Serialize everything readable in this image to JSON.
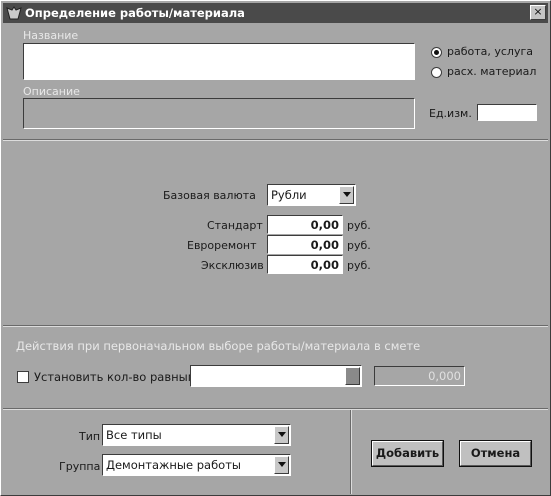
{
  "window": {
    "title": "Определение работы/материала",
    "close_glyph": "×"
  },
  "name_label": "Название",
  "name_value": "",
  "description_label": "Описание",
  "description_value": "",
  "item_kind": {
    "options": [
      "работа, услуга",
      "расх. материал"
    ],
    "selected": "работа, услуга"
  },
  "unit_label": "Ед.изм.",
  "unit_value": "",
  "currency_label": "Базовая валюта",
  "currency_value": "Рубли",
  "prices": [
    {
      "label": "Стандарт",
      "value": "0,00",
      "unit": "руб."
    },
    {
      "label": "Евроремонт",
      "value": "0,00",
      "unit": "руб."
    },
    {
      "label": "Эксклюзив",
      "value": "0,00",
      "unit": "руб."
    }
  ],
  "actions_heading": "Действия при первоначальном выборе работы/материала в смете",
  "set_qty": {
    "label": "Установить кол-во равным",
    "checked": false,
    "value": "0,000"
  },
  "type_label": "Тип",
  "type_value": "Все типы",
  "group_label": "Группа",
  "group_value": "Демонтажные работы",
  "buttons": {
    "add": "Добавить",
    "cancel": "Отмена"
  },
  "icons": {
    "app": "app-icon",
    "close": "close-icon",
    "dropdown": "chevron-down-icon"
  },
  "colors": {
    "titlebar": "#4a4a4a",
    "dialog_bg": "#a6a6a6",
    "field_bg": "#ffffff"
  }
}
